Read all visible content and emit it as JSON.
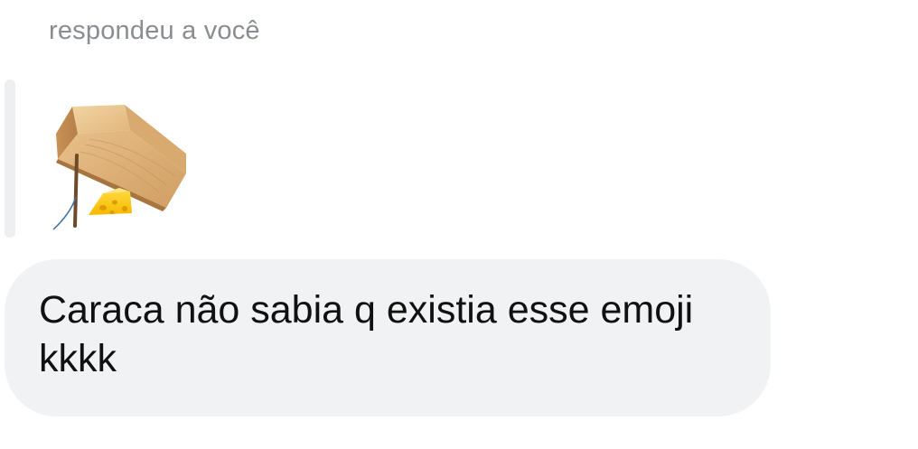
{
  "reply": {
    "context_label": "respondeu a você",
    "quoted_emoji": "mouse-trap-icon"
  },
  "message": {
    "text": "Caraca não sabia q existia esse emoji kkkk"
  },
  "colors": {
    "bubble_bg": "#f1f2f4",
    "context_text": "#8a8d91",
    "message_text": "#111111",
    "quote_bar": "#eeeff1"
  }
}
